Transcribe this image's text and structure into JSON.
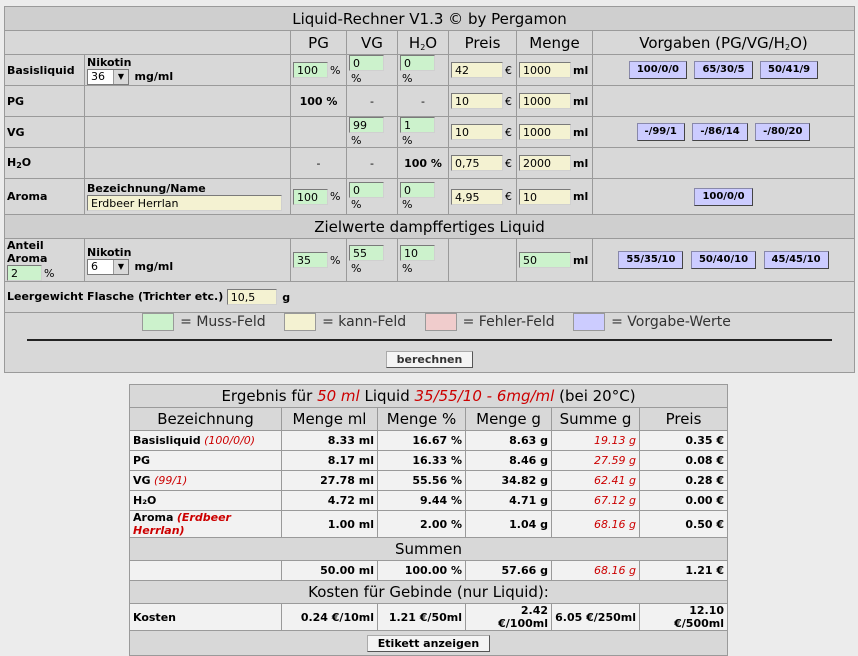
{
  "title": "Liquid-Rechner V1.3 © by Pergamon",
  "headers": {
    "pg": "PG",
    "vg": "VG",
    "h2o_main": "H",
    "h2o_sub": "2",
    "h2o_tail": "O",
    "preis": "Preis",
    "menge": "Menge",
    "vorgaben": "Vorgaben (PG/VG/H",
    "vorgaben_sub": "2",
    "vorgaben_tail": "O)"
  },
  "units": {
    "pct": "%",
    "eur": "€",
    "ml": "ml",
    "mgml": "mg/ml",
    "g": "g"
  },
  "basis": {
    "label": "Basisliquid",
    "nikotin_label": "Nikotin",
    "nikotin": "36",
    "pg": "100",
    "vg": "0",
    "h2o": "0",
    "preis": "42",
    "menge": "1000",
    "presets": [
      "100/0/0",
      "65/30/5",
      "50/41/9"
    ]
  },
  "pg": {
    "label": "PG",
    "pg_static": "100 %",
    "vg_static": "-",
    "h2o_static": "-",
    "preis": "10",
    "menge": "1000"
  },
  "vg": {
    "label": "VG",
    "vg": "99",
    "h2o": "1",
    "preis": "10",
    "menge": "1000",
    "presets": [
      "-/99/1",
      "-/86/14",
      "-/80/20"
    ]
  },
  "h2o": {
    "label_main": "H",
    "label_sub": "2",
    "label_tail": "O",
    "pg_static": "-",
    "vg_static": "-",
    "h2o_static": "100 %",
    "preis": "0,75",
    "menge": "2000"
  },
  "aroma": {
    "label": "Aroma",
    "name_label": "Bezeichnung/Name",
    "name": "Erdbeer Herrlan",
    "pg": "100",
    "vg": "0",
    "h2o": "0",
    "preis": "4,95",
    "menge": "10",
    "presets": [
      "100/0/0"
    ]
  },
  "ziel": {
    "section": "Zielwerte dampffertiges Liquid",
    "anteil_label": "Anteil Aroma",
    "anteil": "2",
    "nikotin_label": "Nikotin",
    "nikotin": "6",
    "pg": "35",
    "vg": "55",
    "h2o": "10",
    "menge": "50",
    "presets": [
      "55/35/10",
      "50/40/10",
      "45/45/10"
    ]
  },
  "flasche": {
    "label": "Leergewicht Flasche (Trichter etc.)",
    "value": "10,5"
  },
  "legend": [
    {
      "label": "= Muss-Feld",
      "color": "#ccf2cc"
    },
    {
      "label": "= kann-Feld",
      "color": "#f4f2d2"
    },
    {
      "label": "= Fehler-Feld",
      "color": "#f0cccc"
    },
    {
      "label": "= Vorgabe-Werte",
      "color": "#ccccff"
    }
  ],
  "berechnen": "berechnen",
  "result": {
    "title_a": "Ergebnis für ",
    "title_amount": "50 ml",
    "title_b": " Liquid ",
    "title_mix": "35/55/10 - 6mg/ml",
    "title_c": " (bei 20°C)",
    "cols": [
      "Bezeichnung",
      "Menge ml",
      "Menge %",
      "Menge g",
      "Summe g",
      "Preis"
    ],
    "rows": [
      {
        "name": "Basisliquid",
        "note": "(100/0/0)",
        "ml": "8.33 ml",
        "pct": "16.67 %",
        "g": "8.63 g",
        "sum": "19.13 g",
        "preis": "0.35 €"
      },
      {
        "name": "PG",
        "note": "",
        "ml": "8.17 ml",
        "pct": "16.33 %",
        "g": "8.46 g",
        "sum": "27.59 g",
        "preis": "0.08 €"
      },
      {
        "name": "VG",
        "note": "(99/1)",
        "ml": "27.78 ml",
        "pct": "55.56 %",
        "g": "34.82 g",
        "sum": "62.41 g",
        "preis": "0.28 €"
      },
      {
        "name": "H₂O",
        "note": "",
        "ml": "4.72 ml",
        "pct": "9.44 %",
        "g": "4.71 g",
        "sum": "67.12 g",
        "preis": "0.00 €"
      },
      {
        "name": "Aroma",
        "note": "(Erdbeer Herrlan)",
        "ml": "1.00 ml",
        "pct": "2.00 %",
        "g": "1.04 g",
        "sum": "68.16 g",
        "preis": "0.50 €"
      }
    ],
    "summen_title": "Summen",
    "summen": {
      "ml": "50.00 ml",
      "pct": "100.00 %",
      "g": "57.66 g",
      "sum": "68.16 g",
      "preis": "1.21 €"
    },
    "kosten_title": "Kosten für Gebinde (nur Liquid):",
    "kosten": {
      "label": "Kosten",
      "c1": "0.24 €/10ml",
      "c2": "1.21 €/50ml",
      "c3": "2.42 €/100ml",
      "c4": "6.05 €/250ml",
      "c5": "12.10 €/500ml"
    },
    "etikett": "Etikett anzeigen"
  }
}
